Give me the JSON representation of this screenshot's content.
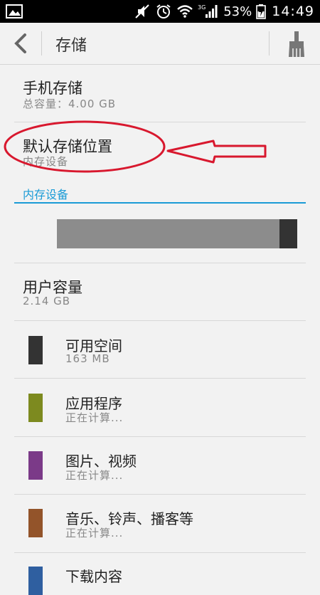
{
  "status_bar": {
    "network": "3G",
    "battery_percent": "53%",
    "time": "14:49"
  },
  "action_bar": {
    "title": "存储",
    "back_icon": "chevron-left-icon",
    "action_icon": "broom-icon"
  },
  "phone_storage": {
    "title": "手机存储",
    "total_capacity": "总容量：4.00  GB"
  },
  "default_location": {
    "title": "默认存储位置",
    "value": "内存设备"
  },
  "internal_section": {
    "header": "内存设备",
    "used_fraction": 0.925
  },
  "user_capacity": {
    "title": "用户容量",
    "value": "2.14  GB"
  },
  "categories": [
    {
      "title": "可用空间",
      "value": "163  MB",
      "color": "#333333"
    },
    {
      "title": "应用程序",
      "value": "正在计算...",
      "color": "#7d8a1f"
    },
    {
      "title": "图片、视频",
      "value": "正在计算...",
      "color": "#7b3a88"
    },
    {
      "title": "音乐、铃声、播客等",
      "value": "正在计算...",
      "color": "#93542a"
    },
    {
      "title": "下载内容",
      "value": "",
      "color": "#2f5fa0"
    }
  ],
  "colors": {
    "accent": "#1a9bd6",
    "annotation": "#d8182e"
  }
}
